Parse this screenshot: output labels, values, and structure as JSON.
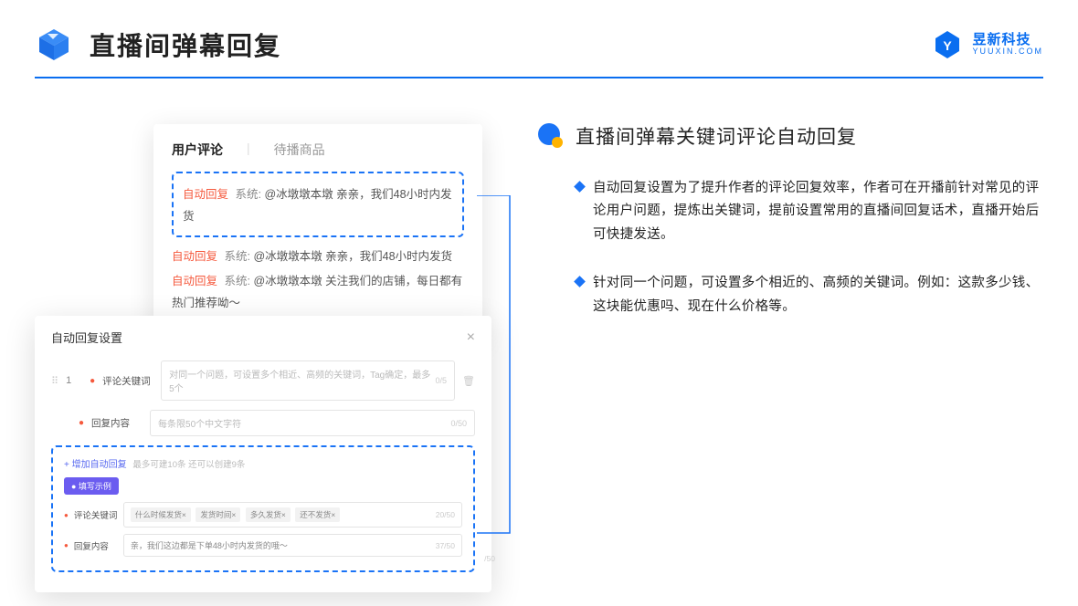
{
  "header": {
    "title": "直播间弹幕回复",
    "brand_cn": "昱新科技",
    "brand_en": "YUUXIN.COM"
  },
  "comment_panel": {
    "tab_active": "用户评论",
    "tab_inactive": "待播商品",
    "row1_tag": "自动回复",
    "row1_sys": "系统:",
    "row1_text": "@冰墩墩本墩 亲亲，我们48小时内发货",
    "row2_tag": "自动回复",
    "row2_sys": "系统:",
    "row2_text": "@冰墩墩本墩 亲亲，我们48小时内发货",
    "row3_tag": "自动回复",
    "row3_sys": "系统:",
    "row3_text": "@冰墩墩本墩 关注我们的店铺，每日都有热门推荐呦～"
  },
  "settings": {
    "title": "自动回复设置",
    "idx": "1",
    "label_keyword": "评论关键词",
    "keyword_ph": "对同一个问题，可设置多个相近、高频的关键词，Tag确定，最多5个",
    "keyword_count": "0/5",
    "label_reply": "回复内容",
    "reply_ph": "每条限50个中文字符",
    "reply_count": "0/50",
    "add_link": "+ 增加自动回复",
    "add_sub": "最多可建10条 还可以创建9条",
    "example_badge": "● 填写示例",
    "ex_label_kw": "评论关键词",
    "ex_tag1": "什么时候发货×",
    "ex_tag2": "发货时间×",
    "ex_tag3": "多久发货×",
    "ex_tag4": "还不发货×",
    "ex_kw_count": "20/50",
    "ex_label_reply": "回复内容",
    "ex_reply_val": "亲，我们这边都是下单48小时内发货的哦～",
    "ex_reply_count": "37/50",
    "float_count": "/50"
  },
  "right": {
    "section_title": "直播间弹幕关键词评论自动回复",
    "bullet1": "自动回复设置为了提升作者的评论回复效率，作者可在开播前针对常见的评论用户问题，提炼出关键词，提前设置常用的直播间回复话术，直播开始后可快捷发送。",
    "bullet2": "针对同一个问题，可设置多个相近的、高频的关键词。例如：这款多少钱、这块能优惠吗、现在什么价格等。"
  }
}
